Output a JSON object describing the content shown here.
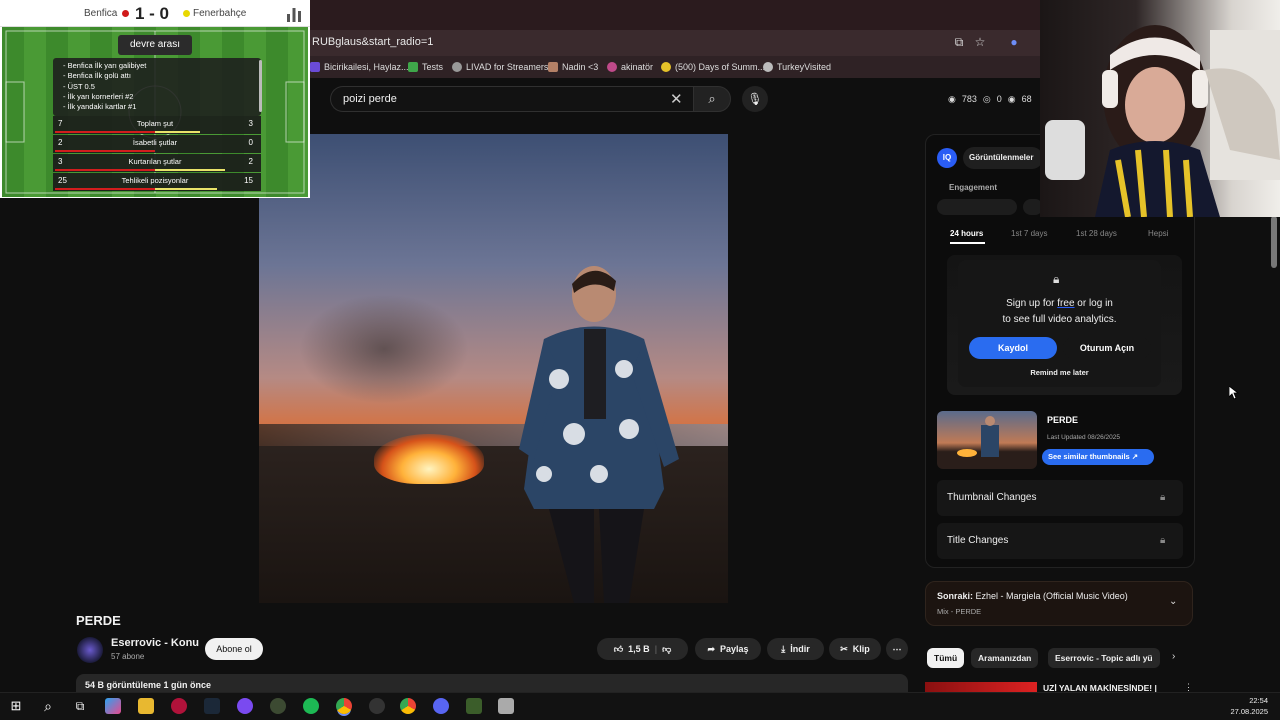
{
  "browser": {
    "url": "RUBglaus&start_radio=1",
    "bookmarks": [
      "Bicirikailesi, Haylaz...",
      "Tests",
      "LIVAD for Streamers",
      "Nadin <3",
      "akinatör",
      "(500) Days of Summ...",
      "TurkeyVisited"
    ]
  },
  "search": {
    "query": "poizi perde"
  },
  "top_stats": {
    "views": "783",
    "comments": "0",
    "watchers": "68"
  },
  "video": {
    "title": "PERDE",
    "channel": "Eserrovic - Konu",
    "subscribers": "57 abone",
    "subscribe_label": "Abone ol",
    "likes": "1,5 B",
    "share_label": "Paylaş",
    "download_label": "İndir",
    "clip_label": "Klip",
    "description": "54 B görüntüleme  1 gün önce"
  },
  "analytics": {
    "logo": "IQ",
    "views_label": "Görüntülenmeler",
    "engagement_label": "Engagement",
    "tabs": [
      "24 hours",
      "1st 7 days",
      "1st 28 days",
      "Hepsi"
    ],
    "signup_prefix": "Sign up for ",
    "signup_free": "free",
    "signup_suffix": " or log in",
    "signup_line2": "to see full video analytics.",
    "register_label": "Kaydol",
    "login_label": "Oturum Açın",
    "remind_label": "Remind me later",
    "thumb_title": "PERDE",
    "last_updated": "Last Updated 08/26/2025",
    "similar_label": "See similar thumbnails ↗",
    "rows": [
      "Thumbnail Changes",
      "Title Changes"
    ]
  },
  "up_next": {
    "prefix": "Sonraki:",
    "title": " Ezhel - Margiela (Official Music Video)",
    "sub": "Mix - PERDE"
  },
  "chips": [
    "Tümü",
    "Aramanızdan",
    "Eserrovic - Topic adlı yü"
  ],
  "recommendation": {
    "title": "UZİ YALAN MAKİNESİNDE! |"
  },
  "scoreboard": {
    "home": "Benfica",
    "away": "Fenerbahçe",
    "score": "1 - 0",
    "status": "devre arası",
    "markets": [
      "Benfica İlk yarı galibiyet",
      "Benfica İlk golü attı",
      "ÜST 0.5",
      "İlk yarı kornerleri #2",
      "İlk yandaki kartlar #1"
    ],
    "stats": [
      {
        "name": "Toplam şut",
        "home": "7",
        "away": "3"
      },
      {
        "name": "İsabetli şutlar",
        "home": "2",
        "away": "0"
      },
      {
        "name": "Kurtarılan şutlar",
        "home": "3",
        "away": "2"
      },
      {
        "name": "Tehlikeli pozisyonlar",
        "home": "25",
        "away": "15"
      }
    ]
  },
  "taskbar": {
    "time": "22:54",
    "date": "27.08.2025"
  }
}
